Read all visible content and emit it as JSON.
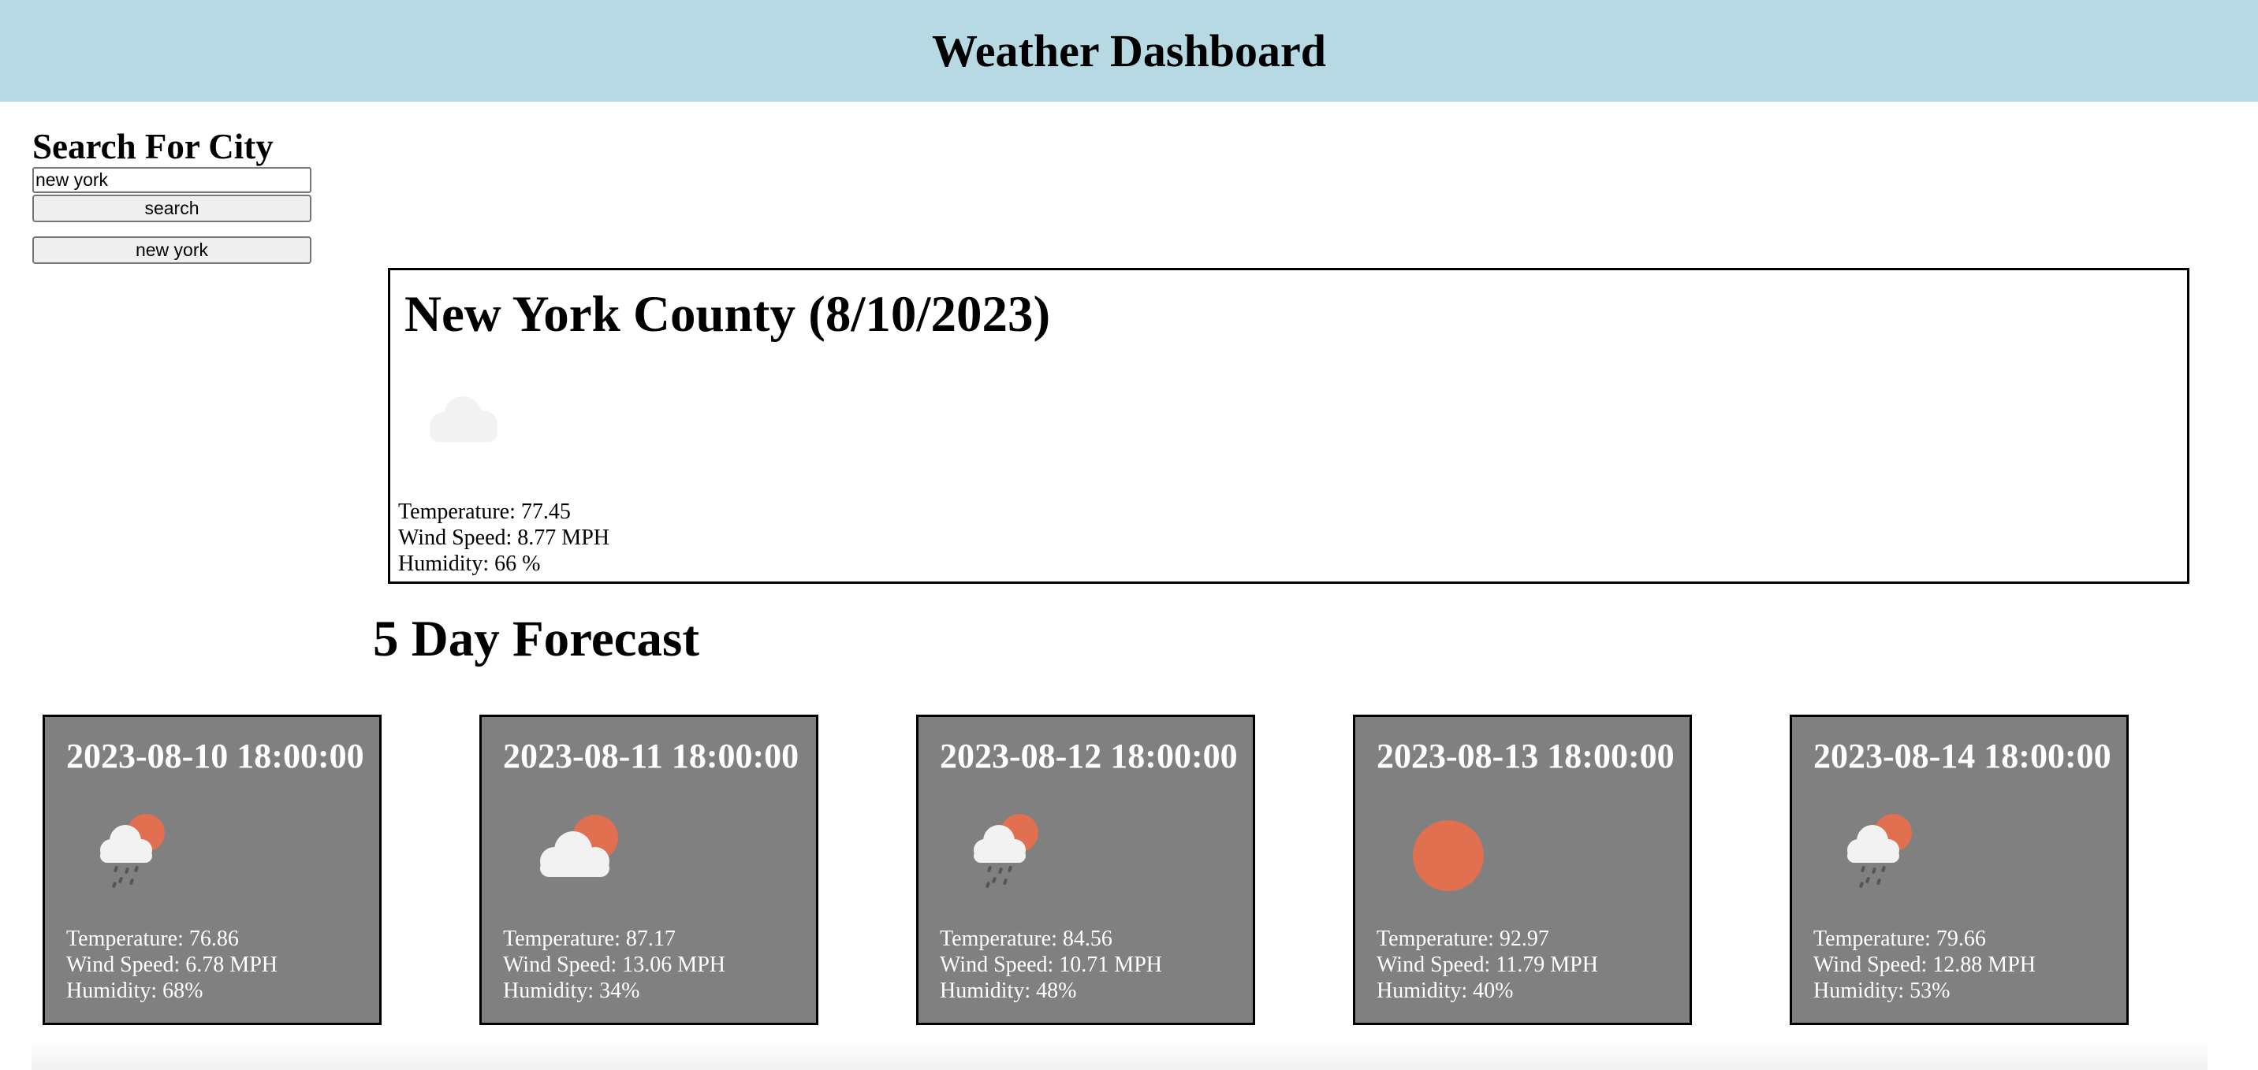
{
  "header": {
    "title": "Weather Dashboard"
  },
  "search": {
    "heading": "Search For City",
    "input_value": "new york",
    "button_label": "search",
    "history": [
      "new york"
    ]
  },
  "current": {
    "title": "New York County (8/10/2023)",
    "icon": "cloud-icon",
    "temperature": "Temperature: 77.45",
    "wind": "Wind Speed: 8.77 MPH",
    "humidity": "Humidity: 66 %"
  },
  "forecast": {
    "heading": "5 Day Forecast",
    "days": [
      {
        "date": "2023-08-10 18:00:00",
        "icon": "rain-sun-icon",
        "temperature": "Temperature: 76.86",
        "wind": "Wind Speed: 6.78 MPH",
        "humidity": "Humidity: 68%"
      },
      {
        "date": "2023-08-11 18:00:00",
        "icon": "cloud-sun-icon",
        "temperature": "Temperature: 87.17",
        "wind": "Wind Speed: 13.06 MPH",
        "humidity": "Humidity: 34%"
      },
      {
        "date": "2023-08-12 18:00:00",
        "icon": "rain-sun-icon",
        "temperature": "Temperature: 84.56",
        "wind": "Wind Speed: 10.71 MPH",
        "humidity": "Humidity: 48%"
      },
      {
        "date": "2023-08-13 18:00:00",
        "icon": "sun-icon",
        "temperature": "Temperature: 92.97",
        "wind": "Wind Speed: 11.79 MPH",
        "humidity": "Humidity: 40%"
      },
      {
        "date": "2023-08-14 18:00:00",
        "icon": "rain-sun-icon",
        "temperature": "Temperature: 79.66",
        "wind": "Wind Speed: 12.88 MPH",
        "humidity": "Humidity: 53%"
      }
    ]
  },
  "colors": {
    "header_bg": "#b6d9e4",
    "card_bg": "#808080",
    "sun": "#e07050",
    "cloud": "#f2f2f2"
  }
}
